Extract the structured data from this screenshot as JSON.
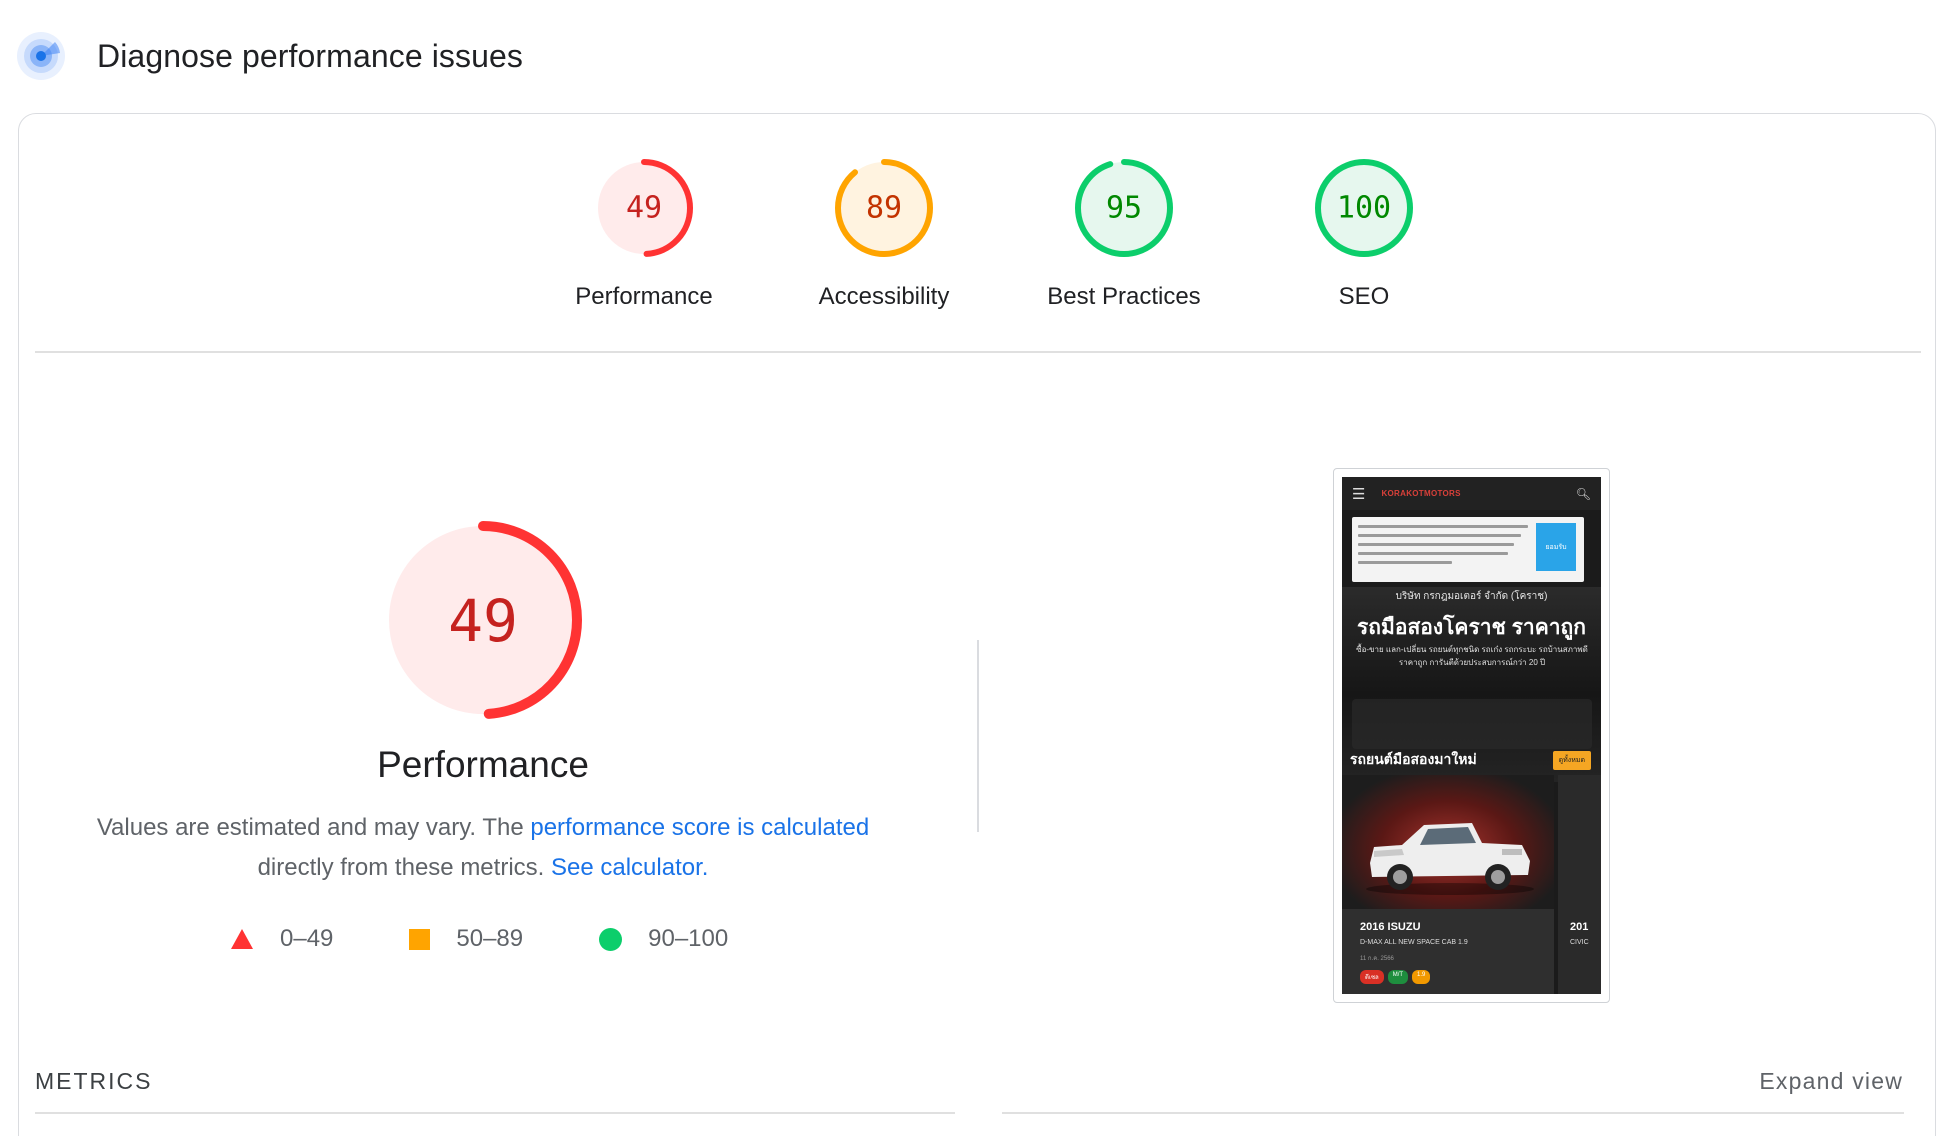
{
  "header": {
    "title": "Diagnose performance issues",
    "icon": "lighthouse-icon"
  },
  "categories": [
    {
      "score": "49",
      "label": "Performance",
      "value": 0.49,
      "status": "fail",
      "color": "#ff3333",
      "text_color": "#c5221f",
      "bg": "#ffebeb"
    },
    {
      "score": "89",
      "label": "Accessibility",
      "value": 0.89,
      "status": "average",
      "color": "#ffa400",
      "text_color": "#c33300",
      "bg": "#fff3e0"
    },
    {
      "score": "95",
      "label": "Best Practices",
      "value": 0.95,
      "status": "pass",
      "color": "#0cce6b",
      "text_color": "#008800",
      "bg": "#e6f7ee"
    },
    {
      "score": "100",
      "label": "SEO",
      "value": 1.0,
      "status": "pass",
      "color": "#0cce6b",
      "text_color": "#008800",
      "bg": "#e6f7ee"
    }
  ],
  "performance": {
    "score": "49",
    "value": 0.49,
    "title": "Performance",
    "color": "#ff3333",
    "text_color": "#c5221f",
    "bg": "#ffebeb",
    "desc_prefix": "Values are estimated and may vary. The ",
    "desc_link1": "performance score is calculated",
    "desc_middle": " directly from these metrics. ",
    "desc_link2": "See calculator."
  },
  "legend": [
    {
      "shape": "triangle",
      "range": "0–49",
      "color": "#ff3333"
    },
    {
      "shape": "square",
      "range": "50–89",
      "color": "#ffa400"
    },
    {
      "shape": "circle",
      "range": "90–100",
      "color": "#0cce6b"
    }
  ],
  "screenshot": {
    "brand": "KORAKOTMOTORS",
    "accept_label": "ยอมรับ",
    "company": "บริษัท กรกฎมอเตอร์ จำกัด (โคราช)",
    "headline": "รถมือสองโคราช ราคาถูก",
    "subline": "ซื้อ-ขาย แลก-เปลี่ยน รถยนต์ทุกชนิด รถเก๋ง รถกระบะ รถบ้านสภาพดี ราคาถูก การันตีด้วยประสบการณ์กว่า 20 ปี",
    "section": "รถยนต์มือสองมาใหม่",
    "more_label": "ดูทั้งหมด",
    "car1_title": "2016 ISUZU",
    "car1_model": "D-MAX ALL NEW SPACE CAB 1.9",
    "car1_date": "11 ก.ค. 2566",
    "car2_title": "201",
    "car2_model": "CIVIC",
    "tags": [
      {
        "text": "ดีเซล",
        "color": "#d93025"
      },
      {
        "text": "M/T",
        "color": "#1e8e3e"
      },
      {
        "text": "1.9",
        "color": "#f29900"
      }
    ]
  },
  "metrics": {
    "label": "METRICS",
    "expand_label": "Expand view"
  }
}
